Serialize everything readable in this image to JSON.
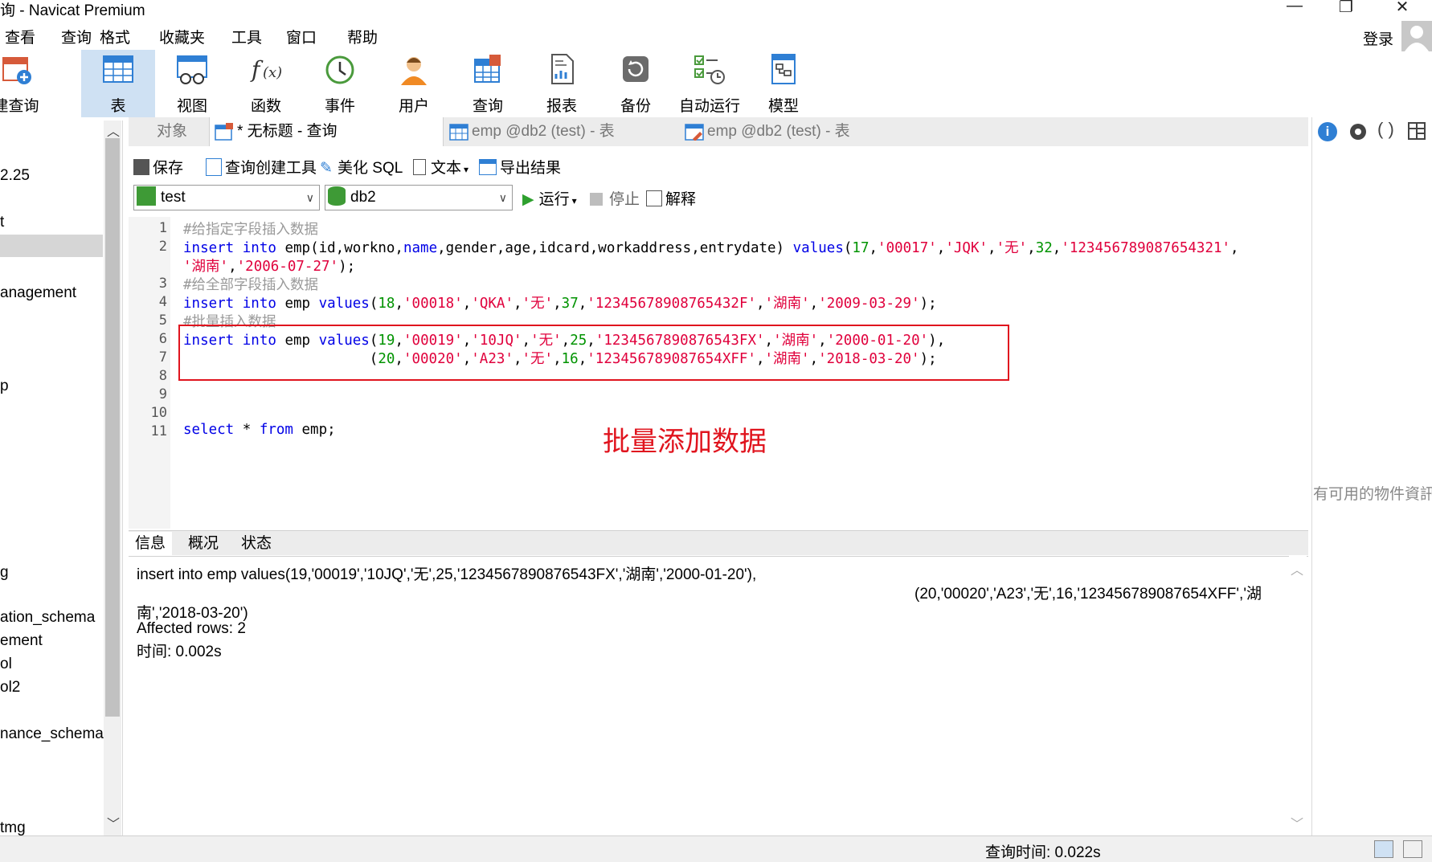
{
  "window": {
    "title": "询 - Navicat Premium"
  },
  "menu": [
    "查看",
    "查询",
    "格式",
    "收藏夹",
    "工具",
    "窗口",
    "帮助"
  ],
  "login_label": "登录",
  "ribbon": [
    {
      "label": "建查询",
      "icon": "new-query-icon"
    },
    {
      "label": "表",
      "icon": "table-icon"
    },
    {
      "label": "视图",
      "icon": "view-icon"
    },
    {
      "label": "函数",
      "icon": "function-icon"
    },
    {
      "label": "事件",
      "icon": "event-clock-icon"
    },
    {
      "label": "用户",
      "icon": "user-icon"
    },
    {
      "label": "查询",
      "icon": "query-icon"
    },
    {
      "label": "报表",
      "icon": "report-icon"
    },
    {
      "label": "备份",
      "icon": "backup-icon"
    },
    {
      "label": "自动运行",
      "icon": "auto-run-icon"
    },
    {
      "label": "模型",
      "icon": "model-icon"
    }
  ],
  "left_panel": [
    "2.25",
    "t",
    "anagement",
    "p",
    "g",
    "ation_schema",
    "ement",
    "ol",
    "ol2",
    "nance_schema",
    "tmg"
  ],
  "tabs": [
    {
      "label": "对象"
    },
    {
      "label": "* 无标题 - 查询"
    },
    {
      "label": "emp @db2 (test) - 表"
    },
    {
      "label": "emp @db2 (test) - 表"
    }
  ],
  "toolbar": {
    "save": "保存",
    "query_builder": "查询创建工具",
    "beautify": "美化 SQL",
    "text": "文本",
    "export": "导出结果",
    "connection": "test",
    "database": "db2",
    "run": "运行",
    "stop": "停止",
    "explain": "解释"
  },
  "editor": {
    "line_numbers": [
      "1",
      "2",
      "3",
      "4",
      "5",
      "6",
      "7",
      "8",
      "9",
      "10",
      "11"
    ],
    "comment1": "#给指定字段插入数据",
    "comment2": "#给全部字段插入数据",
    "comment3": "#批量插入数据"
  },
  "annotation": "批量添加数据",
  "result_tabs": [
    "信息",
    "概况",
    "状态"
  ],
  "result": {
    "line1": "insert into emp values(19,'00019','10JQ','无',25,'1234567890876543FX','湖南','2000-01-20'),",
    "line2": "(20,'00020','A23','无',16,'123456789087654XFF','湖",
    "line3": "南','2018-03-20')",
    "line4": "Affected rows: 2",
    "line5": "时间: 0.002s"
  },
  "right_panel_text": "有可用的物件資訊",
  "status": {
    "query_time": "查询时间: 0.022s"
  }
}
